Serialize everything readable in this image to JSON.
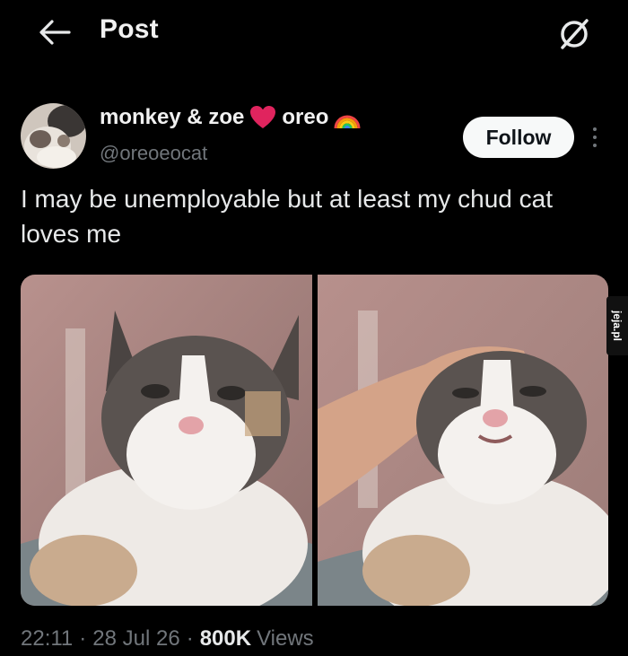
{
  "header": {
    "title": "Post",
    "back_icon": "arrow-left-icon",
    "grok_icon": "grok-icon"
  },
  "author": {
    "name_part1": "monkey & zoe",
    "heart_emoji": "heart-emoji-icon",
    "name_part2": "oreo",
    "rainbow_emoji": "rainbow-emoji-icon",
    "handle": "@oreoeocat",
    "follow_label": "Follow"
  },
  "post": {
    "text": "I may be unemployable but at least my chud cat loves me",
    "media_count": 2
  },
  "meta": {
    "time": "22:11",
    "date": "28 Jul 26",
    "views_count": "800K",
    "views_label": "Views"
  },
  "watermark": {
    "text": "jeja.pl"
  },
  "colors": {
    "background": "#000000",
    "text_primary": "#e7e9ea",
    "text_secondary": "#71767b",
    "follow_bg": "#f7f9f9",
    "heart": "#e0245e"
  }
}
